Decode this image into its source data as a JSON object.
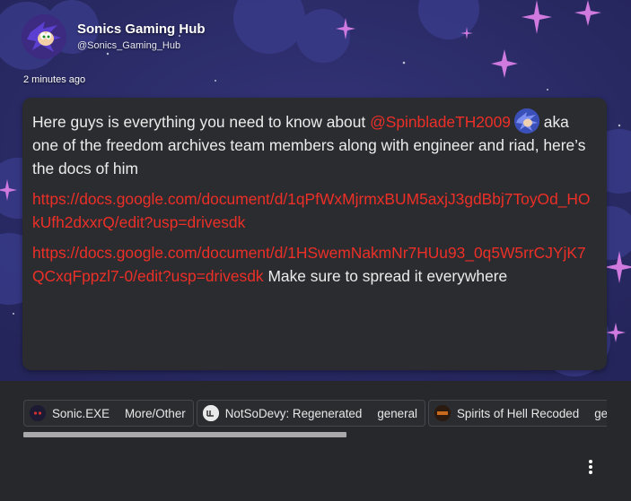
{
  "post": {
    "author": {
      "display_name": "Sonics Gaming Hub",
      "handle": "@Sonics_Gaming_Hub"
    },
    "timestamp": "2 minutes ago",
    "body": {
      "intro": "Here guys is everything you need to know about ",
      "mention": "@SpinbladeTH2009",
      "continuation": " aka one of the freedom archives team members along with engineer and riad, here’s the docs of him",
      "link1": "https://docs.google.com/document/d/1qPfWxMjrmxBUM5axjJ3gdBbj7ToyOd_HOkUfh2dxxrQ/edit?usp=drivesdk",
      "link2": "https://docs.google.com/document/d/1HSwemNakmNr7HUu93_0q5W5rrCJYjK7QCxqFppzl7-0/edit?usp=drivesdk",
      "outro": " Make sure to spread it everywhere"
    }
  },
  "tags": [
    {
      "name": "Sonic.EXE",
      "sub": "More/Other",
      "icon": "sonic-exe-icon"
    },
    {
      "name": "NotSoDevy: Regenerated",
      "sub": "general",
      "icon": "notsodevy-icon"
    },
    {
      "name": "Spirits of Hell Recoded",
      "sub": "general",
      "icon": "spirits-of-hell-icon"
    }
  ],
  "colors": {
    "banner_bg": "#2b2c63",
    "card_bg": "#2b2c30",
    "page_bg": "#26282b",
    "link": "#ec2f27",
    "star": "#d07adf"
  },
  "icons": {
    "more": "more-vertical-icon"
  }
}
